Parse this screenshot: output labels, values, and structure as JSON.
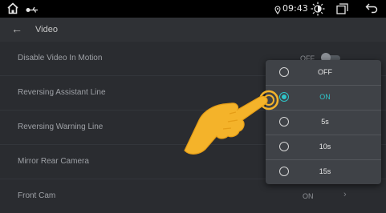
{
  "status": {
    "time": "09:43"
  },
  "header": {
    "title": "Video"
  },
  "settings": [
    {
      "label": "Disable Video In Motion",
      "value": "OFF"
    },
    {
      "label": "Reversing Assistant Line"
    },
    {
      "label": "Reversing Warning Line"
    },
    {
      "label": "Mirror Rear Camera"
    },
    {
      "label": "Front Cam",
      "value": "ON"
    }
  ],
  "dropdown": {
    "options": [
      {
        "label": "OFF",
        "selected": false
      },
      {
        "label": "ON",
        "selected": true
      },
      {
        "label": "5s",
        "selected": false
      },
      {
        "label": "10s",
        "selected": false
      },
      {
        "label": "15s",
        "selected": false
      }
    ]
  },
  "colors": {
    "accent": "#2fc4c8",
    "hand": "#f4b32a",
    "background": "#2a2c30"
  }
}
